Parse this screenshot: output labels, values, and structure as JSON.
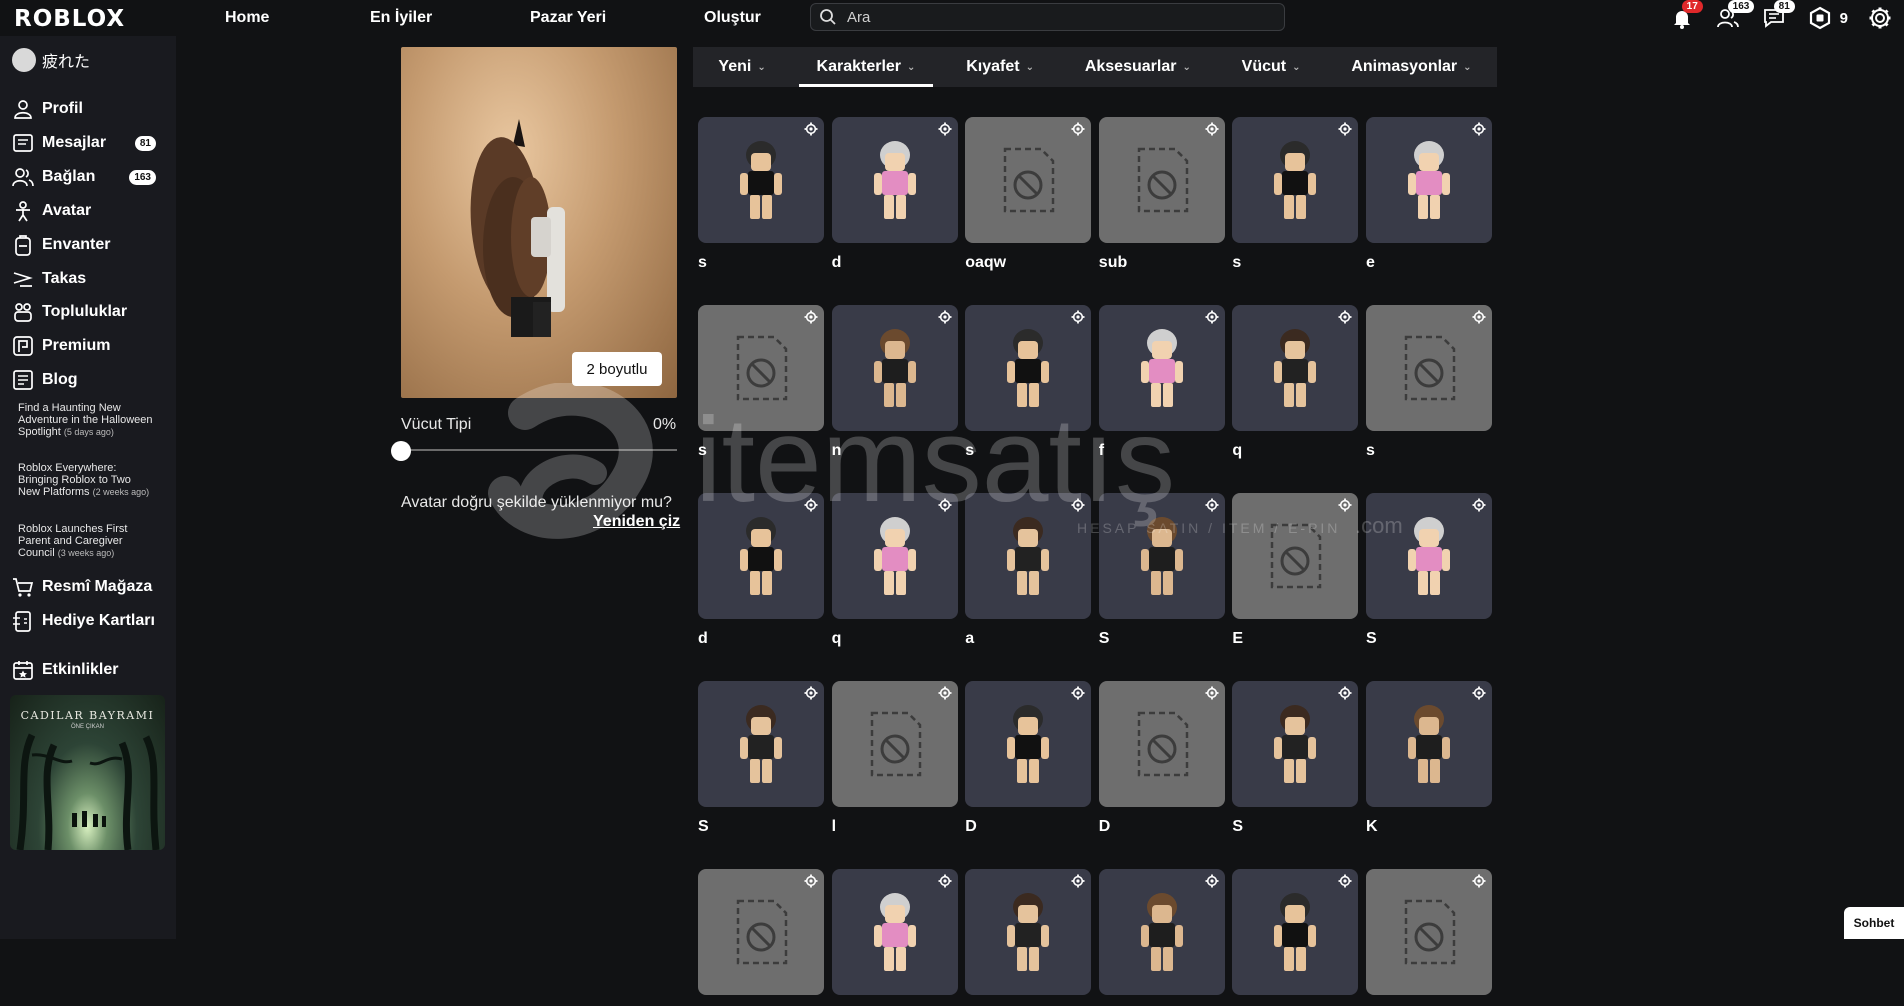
{
  "header": {
    "logo": "ROBLOX",
    "nav": [
      "Home",
      "En İyiler",
      "Pazar Yeri",
      "Oluştur"
    ],
    "search_placeholder": "Ara",
    "notifications_count": "17",
    "friends_count": "163",
    "messages_count": "81",
    "robux": "9"
  },
  "sidebar": {
    "username": "疲れた",
    "items": [
      {
        "label": "Profil",
        "icon": "user-icon"
      },
      {
        "label": "Mesajlar",
        "icon": "message-icon",
        "badge": "81"
      },
      {
        "label": "Bağlan",
        "icon": "friends-icon",
        "badge": "163"
      },
      {
        "label": "Avatar",
        "icon": "avatar-icon"
      },
      {
        "label": "Envanter",
        "icon": "inventory-icon"
      },
      {
        "label": "Takas",
        "icon": "trade-icon"
      },
      {
        "label": "Topluluklar",
        "icon": "communities-icon"
      },
      {
        "label": "Premium",
        "icon": "premium-icon"
      },
      {
        "label": "Blog",
        "icon": "blog-icon"
      }
    ],
    "blog": [
      {
        "title": "Find a Haunting New Adventure in the Halloween Spotlight",
        "ago": "(5 days ago)"
      },
      {
        "title": "Roblox Everywhere: Bringing Roblox to Two New Platforms",
        "ago": "(2 weeks ago)"
      },
      {
        "title": "Roblox Launches First Parent and Caregiver Council",
        "ago": "(3 weeks ago)"
      }
    ],
    "store": "Resmî Mağaza",
    "giftcards": "Hediye Kartları",
    "events": "Etkinlikler",
    "promo_title": "CADILAR BAYRAMI",
    "promo_sub": "ÖNE ÇIKAN"
  },
  "editor": {
    "view_toggle": "2 boyutlu",
    "body_type_label": "Vücut Tipi",
    "body_type_value": "0%",
    "body_type_fraction": 0,
    "warning": "Avatar doğru şekilde yüklenmiyor mu?",
    "redraw": "Yeniden çiz"
  },
  "tabs": [
    {
      "label": "Yeni"
    },
    {
      "label": "Karakterler",
      "active": true
    },
    {
      "label": "Kıyafet"
    },
    {
      "label": "Aksesuarlar"
    },
    {
      "label": "Vücut"
    },
    {
      "label": "Animasyonlar"
    }
  ],
  "characters": [
    {
      "name": "s",
      "ok": true
    },
    {
      "name": "d",
      "ok": true
    },
    {
      "name": "oaqw",
      "ok": false
    },
    {
      "name": "sub",
      "ok": false
    },
    {
      "name": "s",
      "ok": true
    },
    {
      "name": "e",
      "ok": true
    },
    {
      "name": "s",
      "ok": false
    },
    {
      "name": "n",
      "ok": true
    },
    {
      "name": "s",
      "ok": true
    },
    {
      "name": "f",
      "ok": true
    },
    {
      "name": "q",
      "ok": true
    },
    {
      "name": "s",
      "ok": false
    },
    {
      "name": "d",
      "ok": true
    },
    {
      "name": "q",
      "ok": true
    },
    {
      "name": "a",
      "ok": true
    },
    {
      "name": "S",
      "ok": true
    },
    {
      "name": "E",
      "ok": false
    },
    {
      "name": "S",
      "ok": true
    },
    {
      "name": "S",
      "ok": true
    },
    {
      "name": "l",
      "ok": false
    },
    {
      "name": "D",
      "ok": true
    },
    {
      "name": "D",
      "ok": false
    },
    {
      "name": "S",
      "ok": true
    },
    {
      "name": "K",
      "ok": true
    },
    {
      "name": "",
      "ok": false
    },
    {
      "name": "",
      "ok": true
    },
    {
      "name": "",
      "ok": true
    },
    {
      "name": "",
      "ok": true
    },
    {
      "name": "",
      "ok": true
    },
    {
      "name": "",
      "ok": false
    }
  ],
  "watermark": {
    "brand": "itemsatış",
    "tagline": "HESAP SATIN / ITEM / E-PIN",
    "domain": ".com"
  },
  "chat_label": "Sohbet",
  "colors": {
    "background": "#111214",
    "sidebar": "#191a1f",
    "card": "#393b48",
    "unavailable": "#6e6e6e",
    "badge_red": "#e0282a"
  }
}
